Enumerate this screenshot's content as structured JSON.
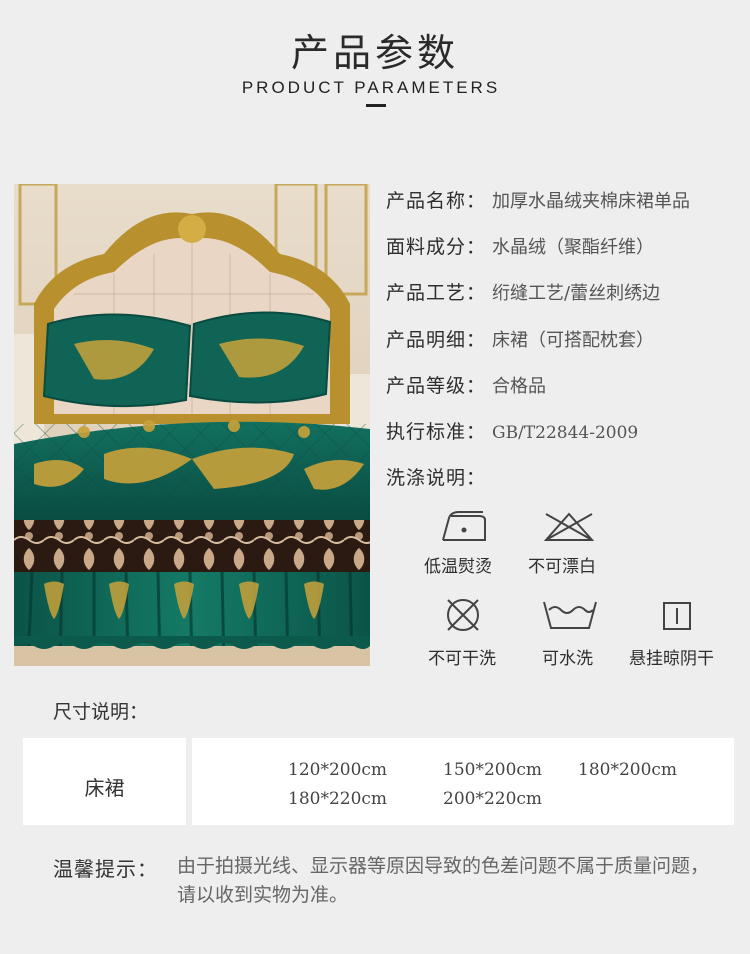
{
  "header": {
    "title_cn": "产品参数",
    "title_en": "PRODUCT PARAMETERS"
  },
  "params": [
    {
      "key": "产品名称：",
      "value": "加厚水晶绒夹棉床裙单品"
    },
    {
      "key": "面料成分：",
      "value": "水晶绒（聚酯纤维）"
    },
    {
      "key": "产品工艺：",
      "value": "绗缝工艺/蕾丝刺绣边"
    },
    {
      "key": "产品明细：",
      "value": "床裙（可搭配枕套）"
    },
    {
      "key": "产品等级：",
      "value": "合格品"
    },
    {
      "key": "执行标准：",
      "value": "GB/T22844-2009"
    },
    {
      "key": "洗涤说明：",
      "value": ""
    }
  ],
  "care": [
    {
      "icon": "low-temp-iron-icon",
      "label": "低温熨烫"
    },
    {
      "icon": "no-bleach-icon",
      "label": "不可漂白"
    },
    {
      "icon": "no-dry-clean-icon",
      "label": "不可干洗"
    },
    {
      "icon": "washable-icon",
      "label": "可水洗"
    },
    {
      "icon": "hang-dry-shade-icon",
      "label": "悬挂晾阴干"
    }
  ],
  "size": {
    "heading": "尺寸说明：",
    "item": "床裙",
    "values": [
      "120*200cm",
      "150*200cm",
      "180*200cm",
      "180*220cm",
      "200*220cm"
    ]
  },
  "note": {
    "key": "温馨提示：",
    "text": "由于拍摄光线、显示器等原因导致的色差问题不属于质量问题，请以收到实物为准。"
  },
  "colors": {
    "background": "#eeeeee",
    "velvet_green": "#0e5a4e",
    "gold_embroidery": "#c9a23a",
    "headboard_gold": "#b8912e",
    "headboard_cushion": "#e9d6c4"
  }
}
